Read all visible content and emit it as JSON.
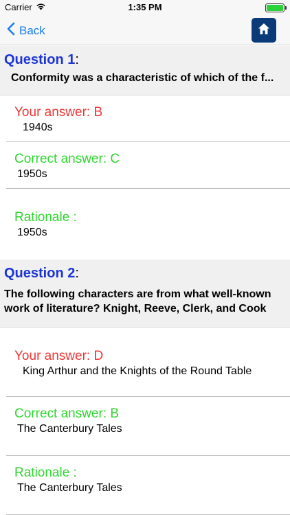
{
  "status": {
    "carrier": "Carrier",
    "time": "1:35 PM"
  },
  "nav": {
    "back_label": "Back"
  },
  "questions": [
    {
      "title": "Question 1",
      "colon": ":",
      "text": "Conformity was a characteristic of which of the f...",
      "your_answer_label": "Your answer: B",
      "your_answer_value": "1940s",
      "correct_answer_label": "Correct answer: C",
      "correct_answer_value": "1950s",
      "rationale_label": "Rationale :",
      "rationale_value": "1950s"
    },
    {
      "title": "Question 2",
      "colon": ":",
      "text": "The following characters are from what well-known work of literature? Knight, Reeve, Clerk, and Cook",
      "your_answer_label": "Your answer: D",
      "your_answer_value": "King Arthur and the Knights of the Round Table",
      "correct_answer_label": "Correct answer: B",
      "correct_answer_value": "The Canterbury Tales",
      "rationale_label": "Rationale :",
      "rationale_value": "The Canterbury Tales"
    }
  ],
  "colors": {
    "question_title": "#1c34d6",
    "wrong": "#f03535",
    "correct": "#2fd62f",
    "nav_accent": "#1a7bf0",
    "home_bg": "#0a3a78"
  }
}
